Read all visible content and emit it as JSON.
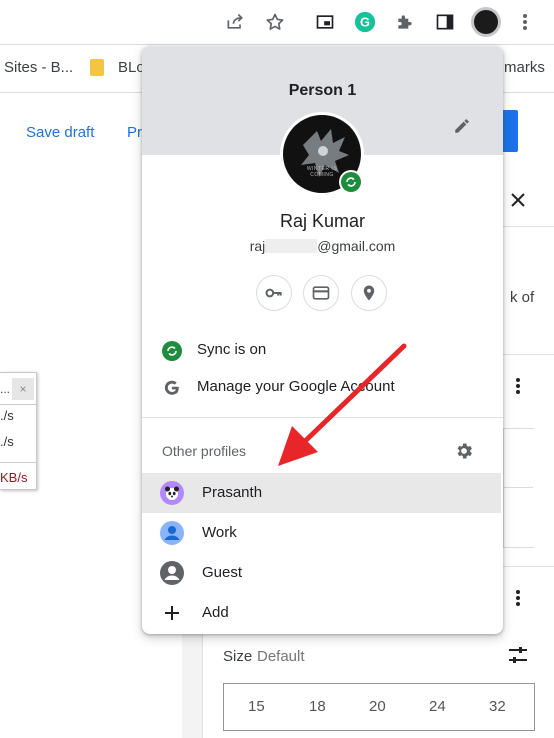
{
  "browser": {
    "bookmarks": [
      {
        "label": "Sites - B..."
      },
      {
        "label": "BLo"
      },
      {
        "label": "marks"
      }
    ]
  },
  "page": {
    "save_draft": "Save draft",
    "preview_partial": "Pr",
    "right_fragment_1": "k of",
    "speed_widget": {
      "line1": "./s",
      "line2": "./s",
      "line3": "KB/s",
      "close": "×",
      "dots": "..."
    },
    "size_label": "Size",
    "size_value": "Default",
    "size_options": [
      "15",
      "18",
      "20",
      "24",
      "32"
    ]
  },
  "profile_menu": {
    "title": "Person 1",
    "user_name": "Raj Kumar",
    "email_prefix": "raj",
    "email_suffix": "@gmail.com",
    "sync_label": "Sync is on",
    "manage_label": "Manage your Google Account",
    "other_profiles_label": "Other profiles",
    "profiles": [
      {
        "label": "Prasanth",
        "selected": true
      },
      {
        "label": "Work"
      },
      {
        "label": "Guest"
      }
    ],
    "add_label": "Add",
    "avatar_text": "WINTER IS COMING"
  },
  "colors": {
    "accent_blue": "#1a73e8",
    "sync_green": "#1e8e3e",
    "annotation_red": "#e8262a",
    "header_gray": "#dfe1e5"
  },
  "icons": {
    "toolbar": [
      "share-icon",
      "star-icon",
      "picture-in-picture-icon",
      "grammarly-icon",
      "extensions-icon",
      "side-panel-icon",
      "profile-avatar-icon",
      "more-vert-icon"
    ],
    "quick_actions": [
      "key-icon",
      "card-icon",
      "location-icon"
    ]
  }
}
